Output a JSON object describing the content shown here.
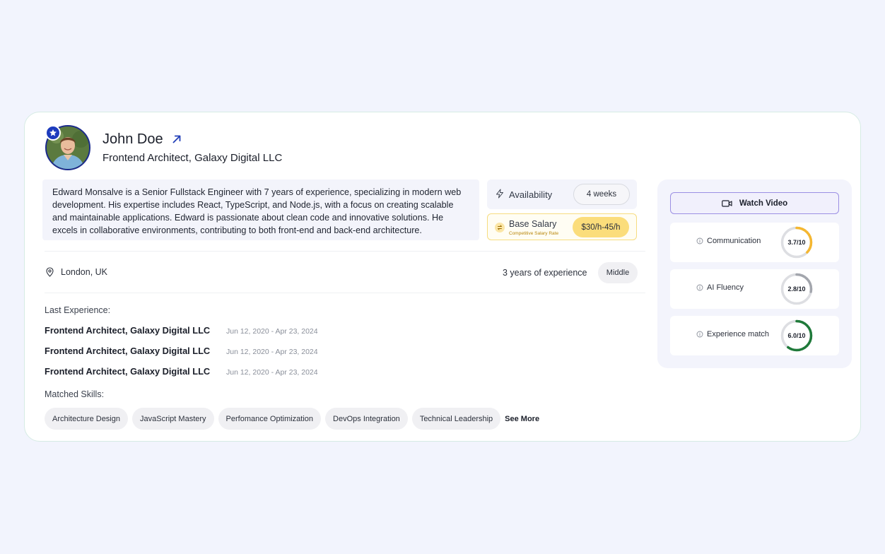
{
  "profile": {
    "name": "John Doe",
    "title": "Frontend Architect, Galaxy Digital LLC",
    "bio": "Edward Monsalve is a Senior Fullstack Engineer with 7 years of experience, specializing in modern web development. His expertise includes React, TypeScript, and Node.js, with a focus on creating scalable and maintainable applications. Edward is passionate about clean code and innovative solutions. He excels in collaborative environments, contributing to both front-end and back-end architecture."
  },
  "availability": {
    "label": "Availability",
    "value": "4 weeks"
  },
  "salary": {
    "label": "Base Salary",
    "sublabel": "Competitive Salary Rate",
    "value": "$30/h-45/h"
  },
  "meta": {
    "location": "London, UK",
    "experience": "3 years of experience",
    "level": "Middle"
  },
  "experience": {
    "label": "Last Experience:",
    "items": [
      {
        "title": "Frontend Architect, Galaxy Digital LLC",
        "dates": "Jun 12, 2020 - Apr 23, 2024"
      },
      {
        "title": "Frontend Architect, Galaxy Digital LLC",
        "dates": "Jun 12, 2020 - Apr 23, 2024"
      },
      {
        "title": "Frontend Architect, Galaxy Digital LLC",
        "dates": "Jun 12, 2020 - Apr 23, 2024"
      }
    ]
  },
  "skills": {
    "label": "Matched Skills:",
    "items": [
      "Architecture Design",
      "JavaScript Mastery",
      "Perfomance Optimization",
      "DevOps Integration",
      "Technical Leadership"
    ],
    "see_more": "See More"
  },
  "panel": {
    "watch_label": "Watch Video",
    "scores": [
      {
        "label": "Communication",
        "value": "3.7/10",
        "fraction": 0.37,
        "color": "#f5b731"
      },
      {
        "label": "AI Fluency",
        "value": "2.8/10",
        "fraction": 0.28,
        "color": "#a3a6ad"
      },
      {
        "label": "Experience match",
        "value": "6.0/10",
        "fraction": 0.6,
        "color": "#1f7a3a"
      }
    ]
  },
  "colors": {
    "accent": "#1d3bbd",
    "video_border": "#9b8fe3",
    "salary_pill": "#fbdd7b"
  },
  "icons": {
    "badge": "star-icon",
    "link": "arrow-up-right-icon",
    "availability": "lightning-icon",
    "salary": "swap-icon",
    "location": "map-pin-icon",
    "video": "video-camera-icon",
    "info": "info-icon"
  }
}
